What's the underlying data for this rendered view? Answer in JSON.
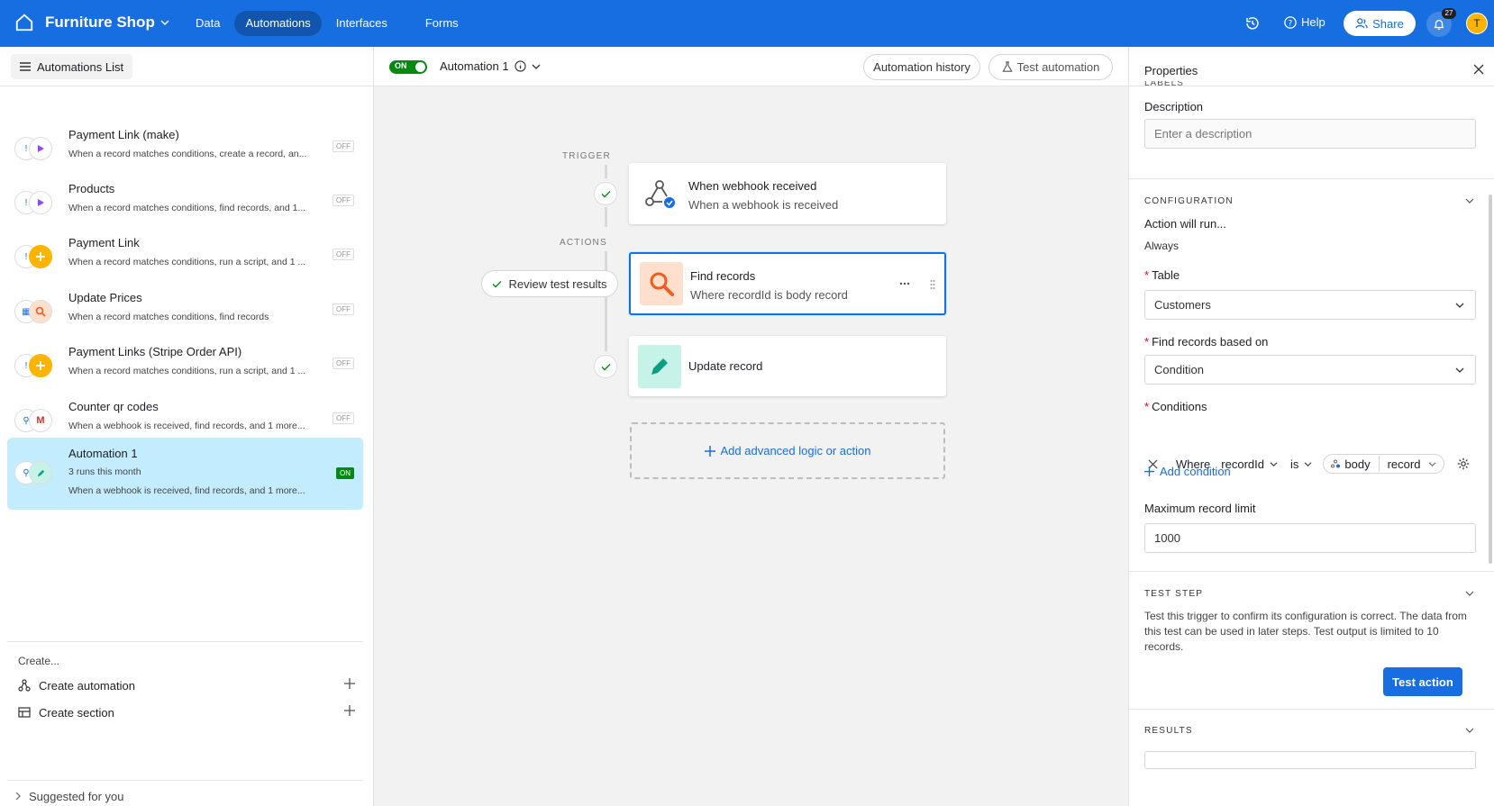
{
  "topbar": {
    "title": "Furniture Shop",
    "nav": [
      "Data",
      "Automations",
      "Interfaces",
      "Forms"
    ],
    "help": "Help",
    "share": "Share",
    "notifications": "27",
    "avatar": "T"
  },
  "sidebar": {
    "list_button": "Automations List",
    "items": [
      {
        "name": "Payment Link (make)",
        "desc": "When a record matches conditions, create a record, an...",
        "status": "OFF"
      },
      {
        "name": "Products",
        "desc": "When a record matches conditions, find records, and 1...",
        "status": "OFF"
      },
      {
        "name": "Payment Link",
        "desc": "When a record matches conditions, run a script, and 1 ...",
        "status": "OFF"
      },
      {
        "name": "Update Prices",
        "desc": "When a record matches conditions, find records",
        "status": "OFF"
      },
      {
        "name": "Payment Links (Stripe Order API)",
        "desc": "When a record matches conditions, run a script, and 1 ...",
        "status": "OFF"
      },
      {
        "name": "Counter qr codes",
        "desc": "When a webhook is received, find records, and 1 more...",
        "status": "OFF"
      },
      {
        "name": "Automation 1",
        "sub": "3 runs this month",
        "desc": "When a webhook is received, find records, and 1 more...",
        "status": "ON"
      }
    ],
    "create_title": "Create...",
    "create_automation": "Create automation",
    "create_section": "Create section",
    "suggested": "Suggested for you"
  },
  "center": {
    "toggle": "ON",
    "automation_name": "Automation 1",
    "history_button": "Automation history",
    "test_button": "Test automation",
    "trigger_label": "TRIGGER",
    "actions_label": "ACTIONS",
    "review_button": "Review test results",
    "trigger_card": {
      "title": "When webhook received",
      "sub": "When a webhook is received"
    },
    "find_card": {
      "title": "Find records",
      "sub": "Where recordId is body record"
    },
    "update_card": {
      "title": "Update record"
    },
    "add_logic": "Add advanced logic or action"
  },
  "properties": {
    "title": "Properties",
    "cut_label": "LABELS",
    "description_label": "Description",
    "description_placeholder": "Enter a description",
    "configuration": "CONFIGURATION",
    "action_will_run": "Action will run...",
    "always": "Always",
    "table_label": "Table",
    "table_value": "Customers",
    "find_based_label": "Find records based on",
    "find_based_value": "Condition",
    "conditions_label": "Conditions",
    "cond_where": "Where",
    "cond_field": "recordId",
    "cond_op": "is",
    "cond_token": "body",
    "cond_token2": "record",
    "add_condition": "Add condition",
    "max_label": "Maximum record limit",
    "max_value": "1000",
    "test_step": "TEST STEP",
    "test_desc": "Test this trigger to confirm its configuration is correct. The data from this test can be used in later steps. Test output is limited to 10 records.",
    "test_action": "Test action",
    "results": "RESULTS"
  },
  "colors": {
    "brand": "#166ee1",
    "on_green": "#048a0e",
    "selected_bg": "#c4ecff"
  }
}
